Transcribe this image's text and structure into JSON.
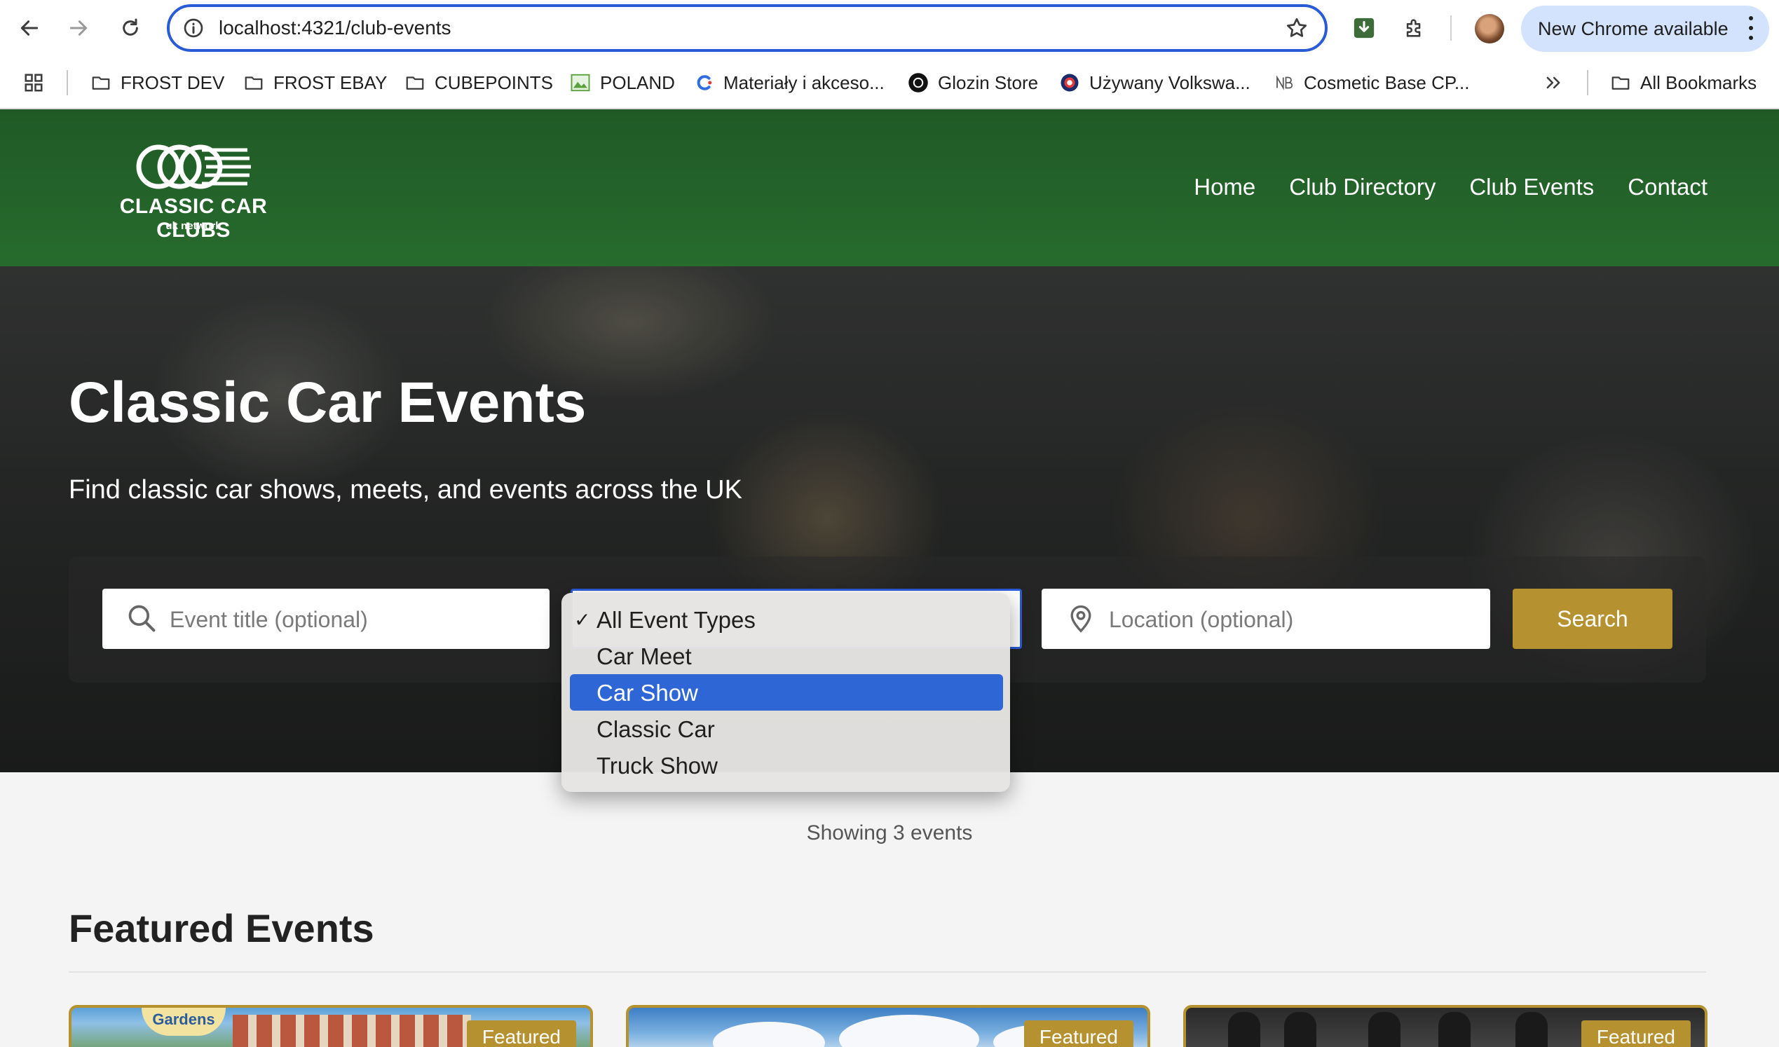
{
  "browser": {
    "url": "localhost:4321/club-events",
    "update_label": "New Chrome available",
    "bookmarks": [
      {
        "label": "FROST DEV",
        "icon": "folder-icon"
      },
      {
        "label": "FROST EBAY",
        "icon": "folder-icon"
      },
      {
        "label": "CUBEPOINTS",
        "icon": "folder-icon"
      },
      {
        "label": "POLAND",
        "icon": "image-icon"
      },
      {
        "label": "Materiały i akceso...",
        "icon": "site-favicon-icon"
      },
      {
        "label": "Glozin Store",
        "icon": "site-favicon-icon"
      },
      {
        "label": "Używany Volkswa...",
        "icon": "site-favicon-icon"
      },
      {
        "label": "Cosmetic Base CP...",
        "icon": "site-favicon-icon"
      }
    ],
    "all_bookmarks_label": "All Bookmarks",
    "accent_color": "#2a5bd7"
  },
  "site": {
    "logo_title": "CLASSIC CAR CLUBS",
    "logo_subtitle": "uk network",
    "nav": [
      "Home",
      "Club Directory",
      "Club Events",
      "Contact"
    ],
    "header_color": "#276b2d",
    "accent_color": "#b5912f"
  },
  "hero": {
    "title": "Classic Car Events",
    "subtitle": "Find classic car shows, meets, and events across the UK"
  },
  "search": {
    "title_placeholder": "Event title (optional)",
    "location_placeholder": "Location (optional)",
    "button_label": "Search",
    "event_type_options": [
      "All Event Types",
      "Car Meet",
      "Car Show",
      "Classic Car",
      "Truck Show"
    ],
    "event_type_checked": "All Event Types",
    "event_type_highlighted": "Car Show"
  },
  "results": {
    "showing_text": "Showing 3 events",
    "featured_heading": "Featured Events",
    "featured_badge": "Featured",
    "card1_sign": "Gardens"
  }
}
